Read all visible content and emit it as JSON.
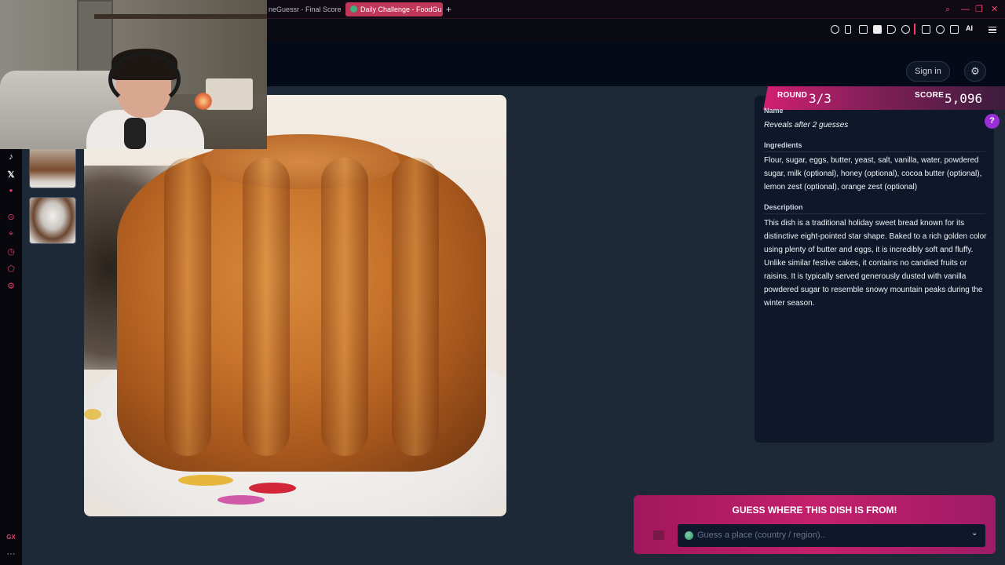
{
  "browser": {
    "tabs": [
      {
        "label": "neGuessr - Final Score",
        "active": false
      },
      {
        "label": "Daily Challenge - FoodGu",
        "active": true
      }
    ],
    "new_tab": "+",
    "window_controls": [
      "search-icon",
      "minimize-icon",
      "restore-icon",
      "close-icon"
    ],
    "toolbar_ai": "AI",
    "sidebar_bottom": "GX",
    "sidebar_more": "···"
  },
  "header": {
    "sign_in": "Sign in",
    "settings_icon": "gear-icon"
  },
  "hud": {
    "round_label": "ROUND",
    "round_value": "3/3",
    "score_label": "SCORE",
    "score_value": "5,096",
    "accent": "#d31f73"
  },
  "info": {
    "name_label": "Name",
    "name_value": "Reveals after 2 guesses",
    "ingredients_label": "Ingredients",
    "ingredients_value": "Flour, sugar, eggs, butter, yeast, salt, vanilla, water, powdered sugar, milk (optional), honey (optional), cocoa butter (optional), lemon zest (optional), orange zest (optional)",
    "description_label": "Description",
    "description_value": "This dish is a traditional holiday sweet bread known for its distinctive eight-pointed star shape. Baked to a rich golden color using plenty of butter and eggs, it is incredibly soft and fluffy. Unlike similar festive cakes, it contains no candied fruits or raisins. It is typically served generously dusted with vanilla powdered sugar to resemble snowy mountain peaks during the winter season."
  },
  "help": "?",
  "guess": {
    "title": "GUESS WHERE THIS DISH IS FROM!",
    "placeholder": "Guess a place (country / region)..",
    "chevron": "⌄"
  }
}
